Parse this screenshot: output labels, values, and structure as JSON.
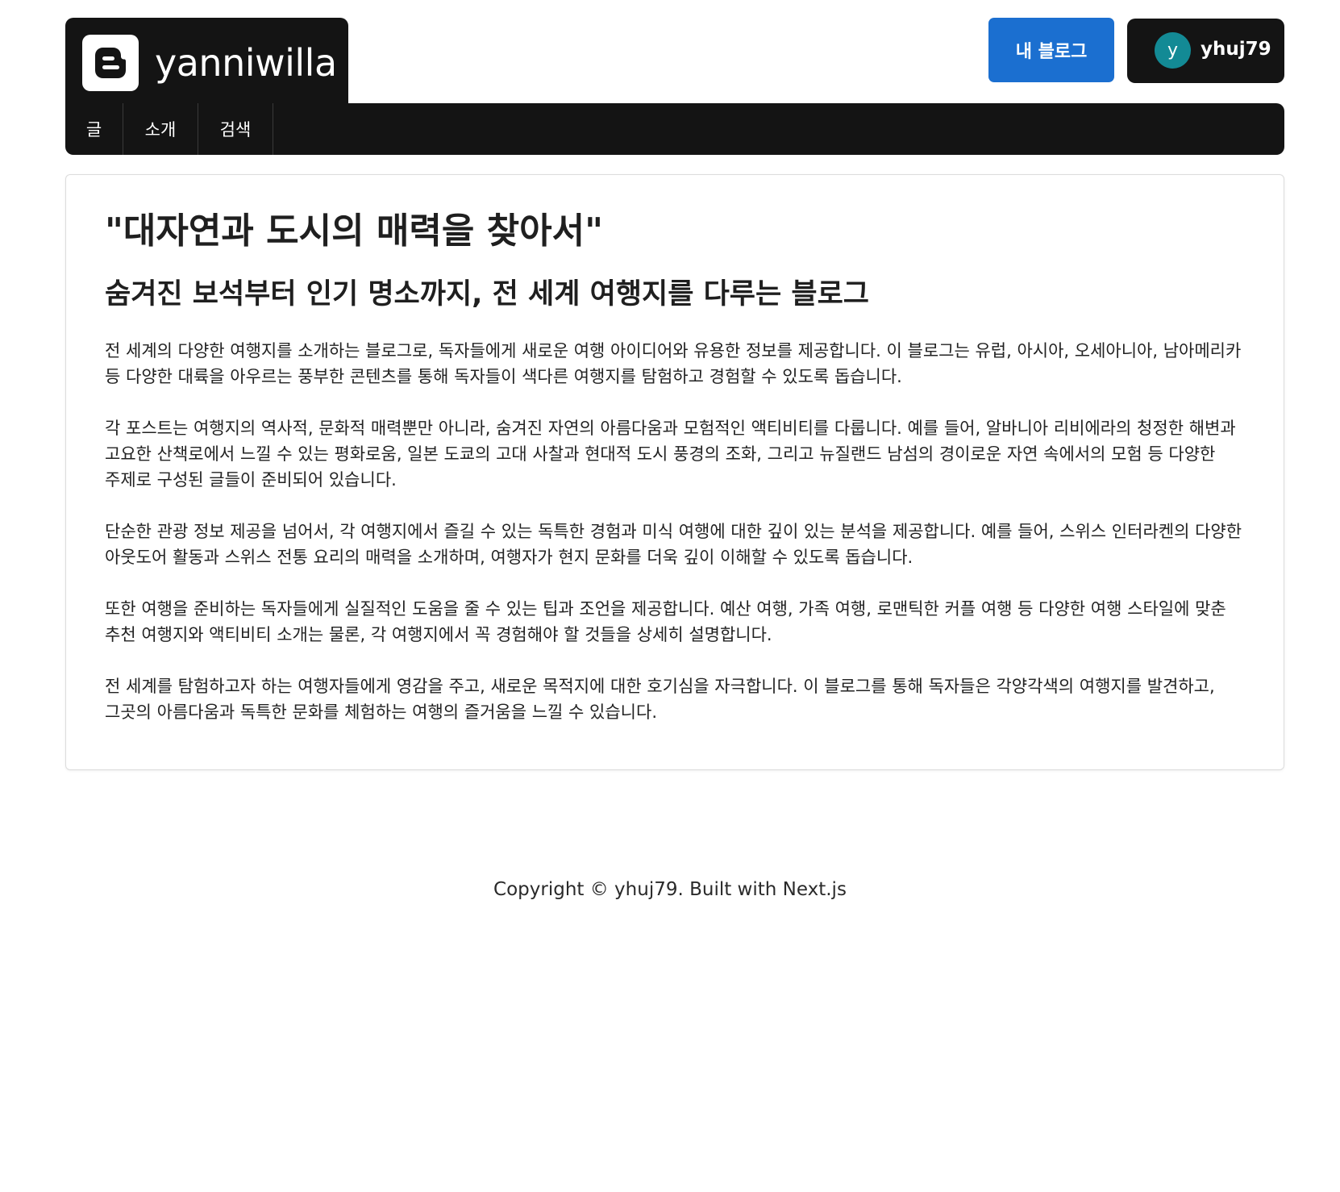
{
  "header": {
    "blog_name": "yanniwilla",
    "logo_icon": "blogger-logo-icon",
    "nav": [
      {
        "label": "글"
      },
      {
        "label": "소개"
      },
      {
        "label": "검색"
      }
    ],
    "my_blog_label": "내 블로그",
    "user": {
      "avatar_initial": "y",
      "username": "yhuj79",
      "avatar_color": "#138a95"
    },
    "accent_color": "#1b6fd0",
    "bar_color": "#141414"
  },
  "post": {
    "title": "\"대자연과 도시의 매력을 찾아서\"",
    "subtitle": "숨겨진 보석부터 인기 명소까지, 전 세계 여행지를 다루는 블로그",
    "paragraphs": [
      "전 세계의 다양한 여행지를 소개하는 블로그로, 독자들에게 새로운 여행 아이디어와 유용한 정보를 제공합니다. 이 블로그는 유럽, 아시아, 오세아니아, 남아메리카 등 다양한 대륙을 아우르는 풍부한 콘텐츠를 통해 독자들이 색다른 여행지를 탐험하고 경험할 수 있도록 돕습니다.",
      "각 포스트는 여행지의 역사적, 문화적 매력뿐만 아니라, 숨겨진 자연의 아름다움과 모험적인 액티비티를 다룹니다. 예를 들어, 알바니아 리비에라의 청정한 해변과 고요한 산책로에서 느낄 수 있는 평화로움, 일본 도쿄의 고대 사찰과 현대적 도시 풍경의 조화, 그리고 뉴질랜드 남섬의 경이로운 자연 속에서의 모험 등 다양한 주제로 구성된 글들이 준비되어 있습니다.",
      "단순한 관광 정보 제공을 넘어서, 각 여행지에서 즐길 수 있는 독특한 경험과 미식 여행에 대한 깊이 있는 분석을 제공합니다. 예를 들어, 스위스 인터라켄의 다양한 아웃도어 활동과 스위스 전통 요리의 매력을 소개하며, 여행자가 현지 문화를 더욱 깊이 이해할 수 있도록 돕습니다.",
      "또한 여행을 준비하는 독자들에게 실질적인 도움을 줄 수 있는 팁과 조언을 제공합니다. 예산 여행, 가족 여행, 로맨틱한 커플 여행 등 다양한 여행 스타일에 맞춘 추천 여행지와 액티비티 소개는 물론, 각 여행지에서 꼭 경험해야 할 것들을 상세히 설명합니다.",
      "전 세계를 탐험하고자 하는 여행자들에게 영감을 주고, 새로운 목적지에 대한 호기심을 자극합니다. 이 블로그를 통해 독자들은 각양각색의 여행지를 발견하고, 그곳의 아름다움과 독특한 문화를 체험하는 여행의 즐거움을 느낄 수 있습니다."
    ]
  },
  "footer": {
    "text": "Copyright © yhuj79. Built with Next.js"
  }
}
